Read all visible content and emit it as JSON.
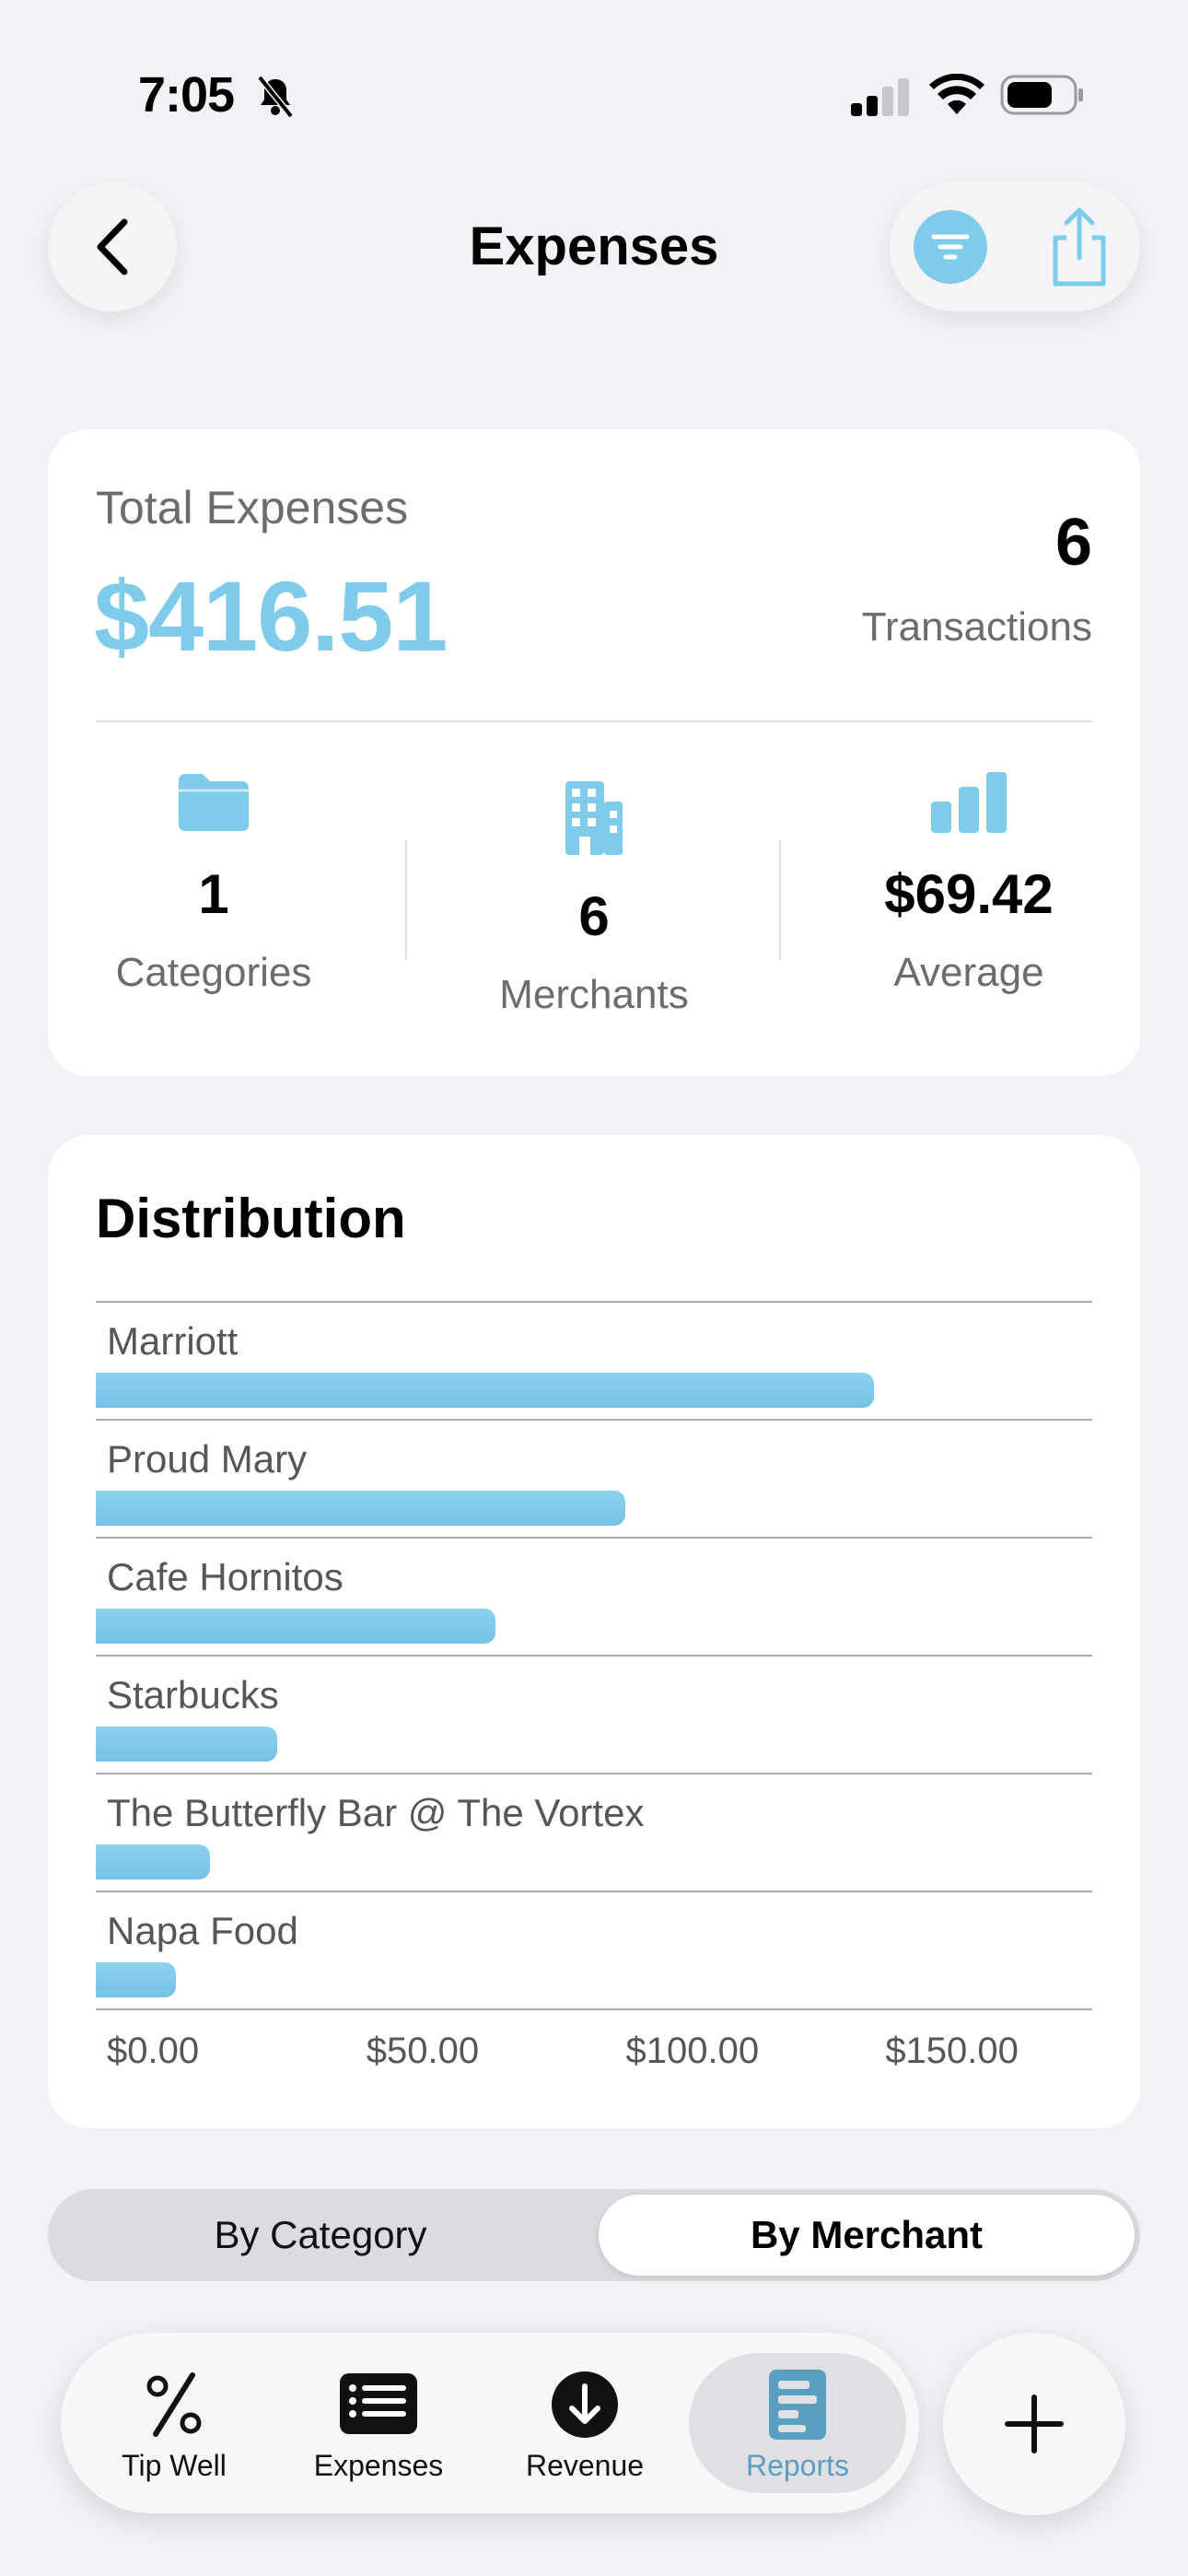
{
  "status_bar": {
    "time": "7:05"
  },
  "header": {
    "title": "Expenses"
  },
  "summary": {
    "total_label": "Total Expenses",
    "total_value": "$416.51",
    "transactions_count": "6",
    "transactions_label": "Transactions",
    "stats": [
      {
        "value": "1",
        "label": "Categories",
        "icon": "folder-icon"
      },
      {
        "value": "6",
        "label": "Merchants",
        "icon": "building-icon"
      },
      {
        "value": "$69.42",
        "label": "Average",
        "icon": "bar-chart-icon"
      }
    ]
  },
  "distribution": {
    "title": "Distribution"
  },
  "chart_data": {
    "type": "bar",
    "orientation": "horizontal",
    "categories": [
      "Marriott",
      "Proud Mary",
      "Cafe Hornitos",
      "Starbucks",
      "The Butterfly Bar @ The Vortex",
      "Napa Food"
    ],
    "values": [
      150,
      102,
      77,
      35,
      22,
      15.5
    ],
    "x_ticks": [
      "$0.00",
      "$50.00",
      "$100.00",
      "$150.00"
    ],
    "xlim": [
      0,
      192
    ],
    "grid": true,
    "bar_color": "#7fcbea"
  },
  "segmented": {
    "by_category": "By Category",
    "by_merchant": "By Merchant",
    "selected": "By Merchant"
  },
  "tabs": [
    {
      "label": "Tip Well",
      "icon": "percent-icon"
    },
    {
      "label": "Expenses",
      "icon": "list-icon"
    },
    {
      "label": "Revenue",
      "icon": "arrow-down-circle-icon"
    },
    {
      "label": "Reports",
      "icon": "report-icon",
      "active": true
    }
  ],
  "colors": {
    "accent": "#7fcbea",
    "background": "#f2f1f6"
  }
}
